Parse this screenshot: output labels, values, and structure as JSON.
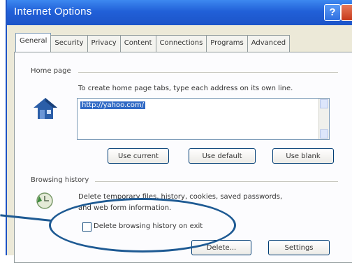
{
  "window": {
    "title": "Internet Options",
    "help_label": "?"
  },
  "tabs": [
    {
      "label": "General",
      "active": true
    },
    {
      "label": "Security"
    },
    {
      "label": "Privacy"
    },
    {
      "label": "Content"
    },
    {
      "label": "Connections"
    },
    {
      "label": "Programs"
    },
    {
      "label": "Advanced"
    }
  ],
  "home_page": {
    "group_label": "Home page",
    "description": "To create home page tabs, type each address on its own line.",
    "url": "http://yahoo.com/",
    "buttons": {
      "use_current": "Use current",
      "use_default": "Use default",
      "use_blank": "Use blank"
    }
  },
  "browsing_history": {
    "group_label": "Browsing history",
    "description_line1": "Delete temporary files, history, cookies, saved passwords,",
    "description_line2": "and web form information.",
    "checkbox_label": "Delete browsing history on exit",
    "checkbox_checked": false,
    "buttons": {
      "delete": "Delete...",
      "settings": "Settings"
    }
  },
  "colors": {
    "titlebar": "#2160d8",
    "annotation_circle": "#1e5a93",
    "selection": "#316ac5"
  }
}
